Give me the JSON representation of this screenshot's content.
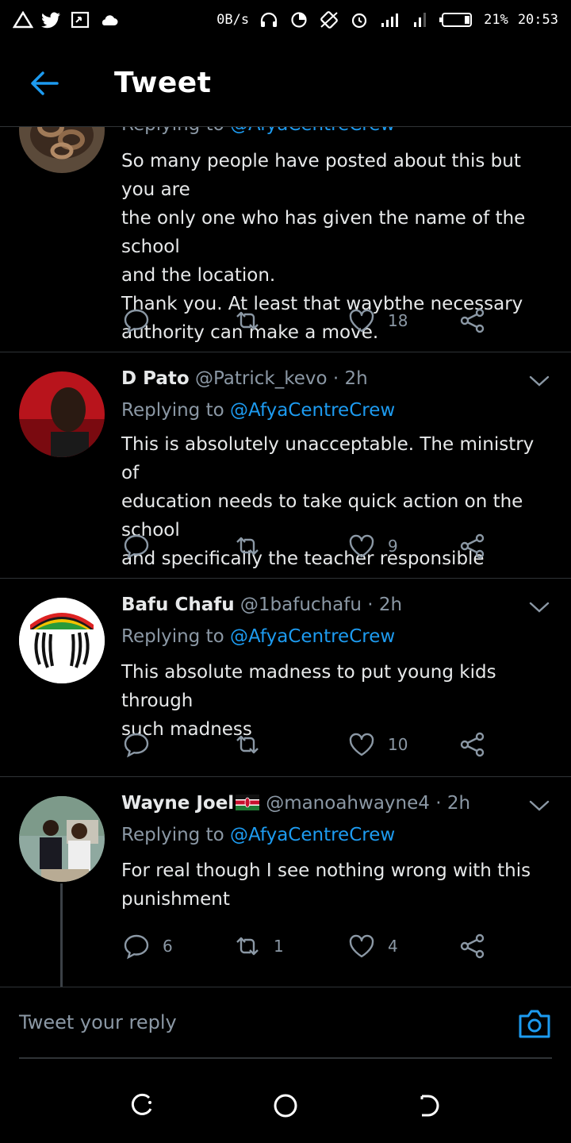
{
  "status_bar": {
    "net_speed": "0B/s",
    "battery": "21%",
    "time": "20:53"
  },
  "header": {
    "title": "Tweet"
  },
  "tweets": [
    {
      "replying_prefix": "Replying to",
      "replying_to": "@AfyaCentreCrew",
      "lines": [
        "So many people have posted about this but you are",
        "the only one who has given the name of the school",
        "and the location.",
        "Thank you. At least that waybthe necessary",
        "authority can make a move."
      ],
      "replies": "",
      "retweets": "",
      "likes": "18"
    },
    {
      "name": "D Pato",
      "handle": "@Patrick_kevo",
      "time": "· 2h",
      "replying_prefix": "Replying to",
      "replying_to": "@AfyaCentreCrew",
      "lines": [
        "This is absolutely unacceptable. The ministry of",
        "education needs to take quick action on the school",
        "and specifically the teacher responsible"
      ],
      "replies": "",
      "retweets": "",
      "likes": "9"
    },
    {
      "name": "Bafu Chafu",
      "handle": "@1bafuchafu",
      "time": "· 2h",
      "replying_prefix": "Replying to",
      "replying_to": "@AfyaCentreCrew",
      "lines": [
        "This absolute madness to put young kids through",
        "such madness"
      ],
      "replies": "",
      "retweets": "",
      "likes": "10"
    },
    {
      "name": "Wayne Joel",
      "handle": "@manoahwayne4",
      "time": "· 2h",
      "replying_prefix": "Replying to",
      "replying_to": "@AfyaCentreCrew",
      "lines": [
        "For real though I see nothing wrong with this",
        "punishment"
      ],
      "replies": "6",
      "retweets": "1",
      "likes": "4"
    }
  ],
  "reply_bar": {
    "placeholder": "Tweet your reply"
  },
  "colors": {
    "accent": "#1d9bf0",
    "background": "#000000",
    "muted": "#8b98a5",
    "divider": "#2f3336"
  }
}
